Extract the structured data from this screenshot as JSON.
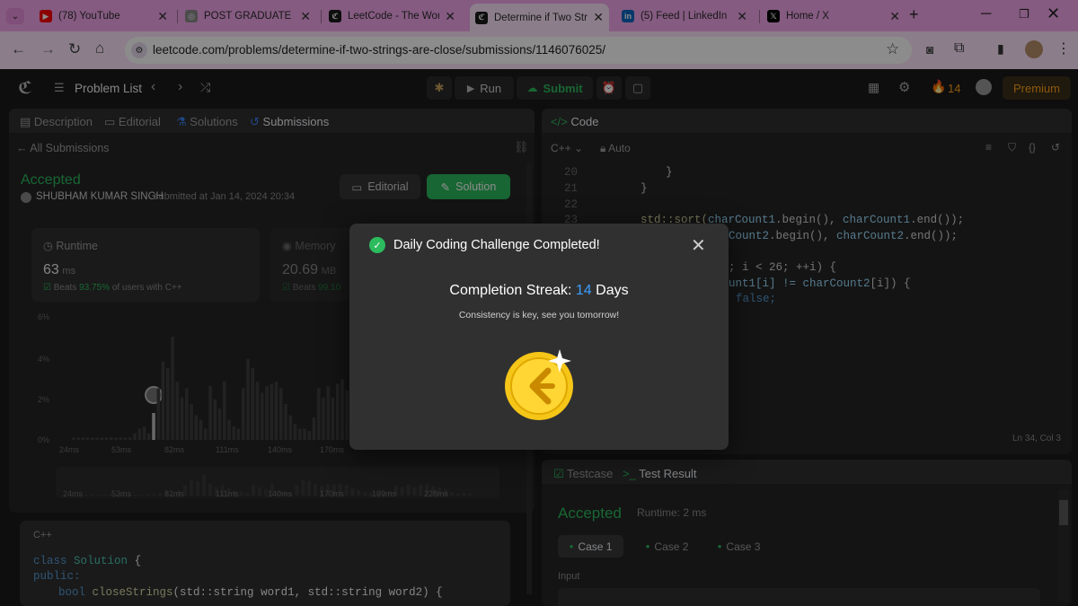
{
  "browser": {
    "tabs": [
      {
        "title": "(78) YouTube",
        "icon": "youtube-icon",
        "color": "#ff0000"
      },
      {
        "title": "POST GRADUATE DIPL",
        "icon": "globe-icon",
        "color": "#8a8a8a"
      },
      {
        "title": "LeetCode - The World",
        "icon": "leetcode-icon",
        "color": "#1a1a1a"
      },
      {
        "title": "Determine if Two Strin",
        "icon": "leetcode-icon",
        "color": "#1a1a1a"
      },
      {
        "title": "(5) Feed | LinkedIn",
        "icon": "linkedin-icon",
        "color": "#0a66c2"
      },
      {
        "title": "Home / X",
        "icon": "x-icon",
        "color": "#000000"
      }
    ],
    "active_tab": 3,
    "url": "leetcode.com/problems/determine-if-two-strings-are-close/submissions/1146076025/"
  },
  "nav": {
    "problem_list": "Problem List",
    "run": "Run",
    "submit": "Submit",
    "streak": "14",
    "premium": "Premium"
  },
  "left": {
    "tabs": {
      "description": "Description",
      "editorial": "Editorial",
      "solutions": "Solutions",
      "submissions": "Submissions"
    },
    "all_submissions": "All Submissions",
    "status": "Accepted",
    "user": "SHUBHAM KUMAR SINGH",
    "submitted_at": "submitted at Jan 14, 2024 20:34",
    "editorial_btn": "Editorial",
    "solution_btn": "Solution",
    "runtime": {
      "label": "Runtime",
      "value": "63",
      "unit": "ms",
      "beats_prefix": "Beats",
      "beats": "93.75%",
      "beats_suffix": "of users with C++"
    },
    "memory": {
      "label": "Memory",
      "value": "20.69",
      "unit": "MB",
      "beats_prefix": "Beats",
      "beats": "99.10"
    },
    "y_ticks": [
      "6%",
      "4%",
      "2%",
      "0%"
    ],
    "x_ticks": [
      "24ms",
      "53ms",
      "82ms",
      "111ms",
      "140ms",
      "170ms"
    ],
    "mini_ticks": [
      "24ms",
      "53ms",
      "82ms",
      "111ms",
      "140ms",
      "170ms",
      "199ms",
      "228ms"
    ],
    "lang": "C++",
    "code": {
      "l1a": "class",
      "l1b": "Solution",
      "l1c": "{",
      "l2": "public:",
      "l3a": "bool",
      "l3b": "closeStrings",
      "l3c": "(std::string word1, std::string word2) {"
    }
  },
  "editor": {
    "title": "Code",
    "lang": "C++",
    "mode": "Auto",
    "lines": [
      "20",
      "21",
      "22",
      "23"
    ],
    "l20": "}",
    "l21": "}",
    "l23a": "std::sort(",
    "l23b": "charCount1",
    "l23c": ".begin(), ",
    "l23d": "charCount1",
    "l23e": ".end());",
    "l24a": "Count2",
    "l24b": ".begin(), ",
    "l24c": "charCount2",
    "l24d": ".end());",
    "l26a": "; i < 26; ++i) {",
    "l27a": "unt1[i] != ",
    "l27b": "charCount2",
    "l27c": "[i]) {",
    "l28": "false;",
    "status": "Ln 34, Col 3"
  },
  "result": {
    "testcase": "Testcase",
    "test_result": "Test Result",
    "status": "Accepted",
    "runtime": "Runtime: 2 ms",
    "cases": [
      "Case 1",
      "Case 2",
      "Case 3"
    ],
    "input_label": "Input"
  },
  "modal": {
    "title": "Daily Coding Challenge Completed!",
    "streak_label": "Completion Streak:",
    "streak_value": "14",
    "streak_unit": "Days",
    "subtitle": "Consistency is key, see you tomorrow!"
  },
  "chart_data": {
    "type": "bar",
    "title": "",
    "xlabel": "",
    "ylabel": "",
    "ylim": [
      0,
      6
    ],
    "x_tick_labels": [
      "24ms",
      "53ms",
      "82ms",
      "111ms",
      "140ms",
      "170ms"
    ],
    "y_tick_labels": [
      "6%",
      "4%",
      "2%",
      "0%"
    ],
    "values": [
      0.1,
      0.1,
      0.1,
      0.1,
      0.1,
      0.1,
      0.1,
      0.1,
      0.1,
      0.1,
      0.1,
      0.1,
      0.1,
      0.3,
      0.5,
      0.6,
      0.3,
      1.2,
      2.3,
      3.5,
      3.2,
      4.6,
      2.6,
      1.9,
      2.3,
      1.6,
      1.1,
      0.9,
      0.5,
      2.4,
      1.8,
      1.4,
      2.6,
      0.9,
      0.6,
      0.5,
      2.3,
      3.6,
      3.2,
      2.6,
      2.1,
      2.4,
      2.5,
      2.6,
      2.3,
      1.6,
      1.1,
      0.7,
      0.5,
      0.5,
      0.4,
      1.0,
      2.3,
      1.9,
      2.4,
      1.9,
      2.5,
      2.7,
      2.2,
      1.8,
      1.5,
      0.8,
      0.4,
      0.6,
      0.4
    ],
    "highlight_index": 17,
    "colors": {
      "bar": "#3e3e3e",
      "highlight": "#bfbfbf"
    }
  }
}
